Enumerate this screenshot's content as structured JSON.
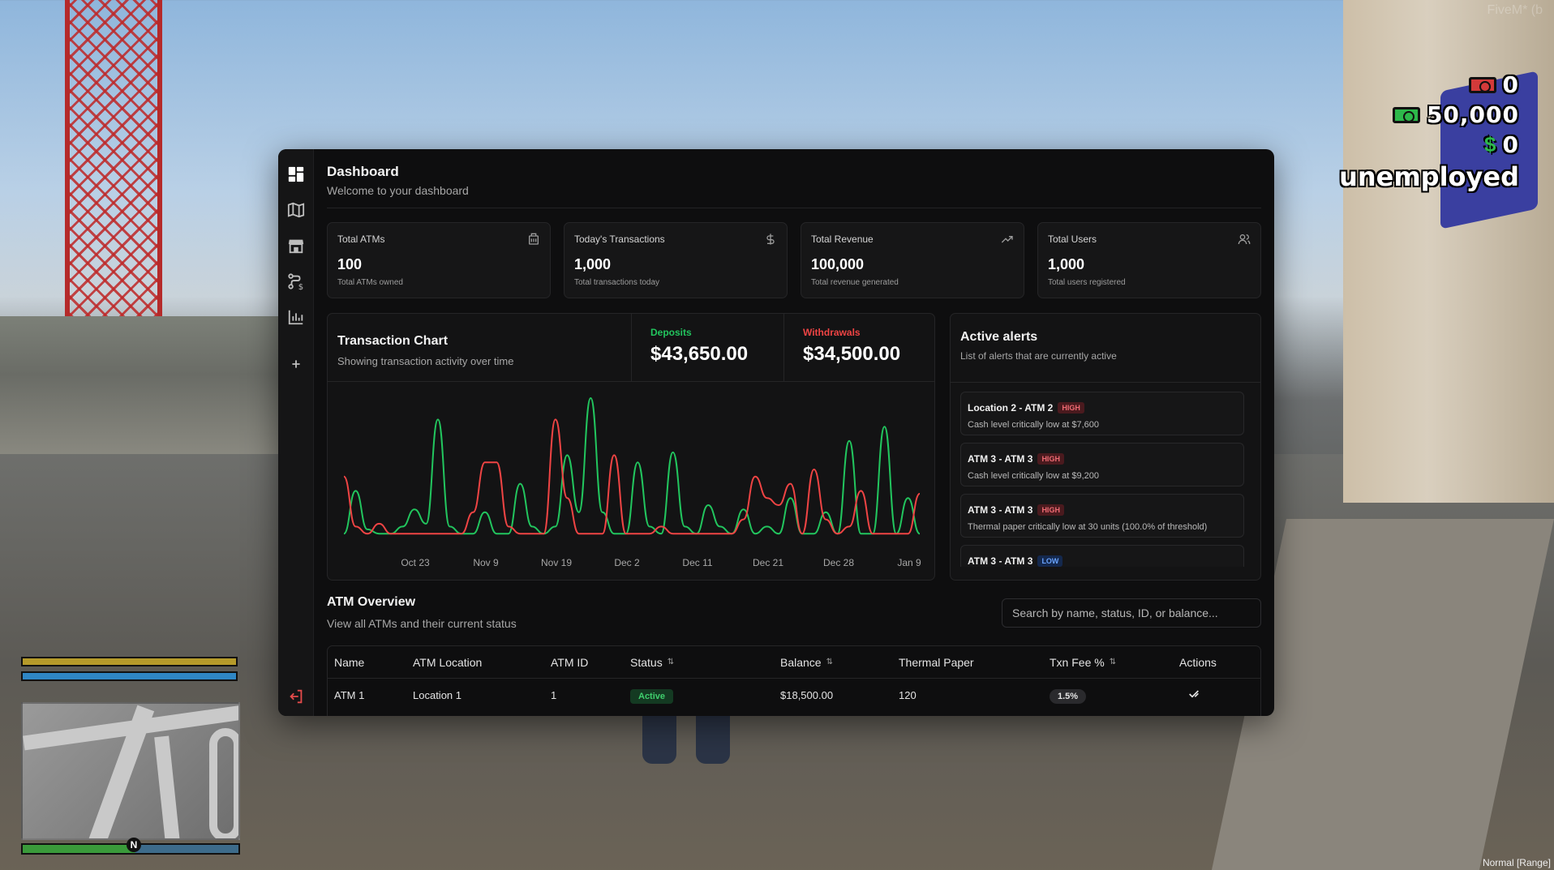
{
  "hud": {
    "bank_amount": "0",
    "cash_amount": "50,000",
    "dollar_sign": "$",
    "black_money": "0",
    "job": "unemployed",
    "watermark": "FiveM* (b",
    "status": "Normal [Range]",
    "compass": "N"
  },
  "sidebar": {
    "items": [
      {
        "name": "dashboard"
      },
      {
        "name": "map"
      },
      {
        "name": "store"
      },
      {
        "name": "transactions"
      },
      {
        "name": "reports"
      },
      {
        "name": "add"
      }
    ]
  },
  "header": {
    "title": "Dashboard",
    "subtitle": "Welcome to your dashboard"
  },
  "stats": [
    {
      "label": "Total ATMs",
      "value": "100",
      "desc": "Total ATMs owned",
      "icon": "atm-icon"
    },
    {
      "label": "Today's Transactions",
      "value": "1,000",
      "desc": "Total transactions today",
      "icon": "dollar-icon"
    },
    {
      "label": "Total Revenue",
      "value": "100,000",
      "desc": "Total revenue generated",
      "icon": "trending-up-icon"
    },
    {
      "label": "Total Users",
      "value": "1,000",
      "desc": "Total users registered",
      "icon": "users-icon"
    }
  ],
  "chart": {
    "title": "Transaction Chart",
    "subtitle": "Showing transaction activity over time",
    "deposits_label": "Deposits",
    "deposits_value": "$43,650.00",
    "withdrawals_label": "Withdrawals",
    "withdrawals_value": "$34,500.00",
    "colors": {
      "deposits": "#22c55e",
      "withdrawals": "#ef4444"
    }
  },
  "chart_data": {
    "type": "line",
    "x_ticks": [
      "Oct 23",
      "Nov 9",
      "Nov 19",
      "Dec 2",
      "Dec 11",
      "Dec 21",
      "Dec 28",
      "Jan 9"
    ],
    "series": [
      {
        "name": "Deposits",
        "values": [
          0.05,
          0.35,
          0.08,
          0.05,
          0.05,
          0.1,
          0.22,
          0.12,
          0.85,
          0.1,
          0.05,
          0.05,
          0.2,
          0.05,
          0.05,
          0.4,
          0.1,
          0.05,
          0.1,
          0.6,
          0.2,
          1.0,
          0.2,
          0.05,
          0.05,
          0.55,
          0.1,
          0.05,
          0.62,
          0.1,
          0.05,
          0.25,
          0.1,
          0.05,
          0.22,
          0.05,
          0.1,
          0.05,
          0.3,
          0.05,
          0.05,
          0.2,
          0.05,
          0.7,
          0.05,
          0.05,
          0.8,
          0.05,
          0.3,
          0.05
        ]
      },
      {
        "name": "Withdrawals",
        "values": [
          0.45,
          0.1,
          0.05,
          0.12,
          0.05,
          0.05,
          0.05,
          0.05,
          0.05,
          0.05,
          0.05,
          0.2,
          0.55,
          0.55,
          0.1,
          0.05,
          0.05,
          0.05,
          0.85,
          0.3,
          0.05,
          0.05,
          0.05,
          0.6,
          0.05,
          0.05,
          0.05,
          0.1,
          0.05,
          0.05,
          0.05,
          0.05,
          0.05,
          0.05,
          0.15,
          0.45,
          0.3,
          0.25,
          0.4,
          0.05,
          0.5,
          0.15,
          0.05,
          0.1,
          0.35,
          0.05,
          0.05,
          0.05,
          0.05,
          0.33
        ]
      }
    ]
  },
  "alerts": {
    "title": "Active alerts",
    "subtitle": "List of alerts that are currently active",
    "items": [
      {
        "name": "Location 2 - ATM 2",
        "severity": "HIGH",
        "desc": "Cash level critically low at $7,600"
      },
      {
        "name": "ATM 3 - ATM 3",
        "severity": "HIGH",
        "desc": "Cash level critically low at $9,200"
      },
      {
        "name": "ATM 3 - ATM 3",
        "severity": "HIGH",
        "desc": "Thermal paper critically low at 30 units (100.0% of threshold)"
      },
      {
        "name": "ATM 3 - ATM 3",
        "severity": "LOW",
        "desc": ""
      }
    ]
  },
  "overview": {
    "title": "ATM Overview",
    "subtitle": "View all ATMs and their current status",
    "search_placeholder": "Search by name, status, ID, or balance...",
    "columns": [
      "Name",
      "ATM Location",
      "ATM ID",
      "Status",
      "Balance",
      "Thermal Paper",
      "Txn Fee %",
      "Actions"
    ],
    "rows": [
      {
        "name": "ATM 1",
        "location": "Location 1",
        "id": "1",
        "status": "Active",
        "balance": "$18,500.00",
        "paper": "120",
        "fee": "1.5%"
      }
    ]
  }
}
